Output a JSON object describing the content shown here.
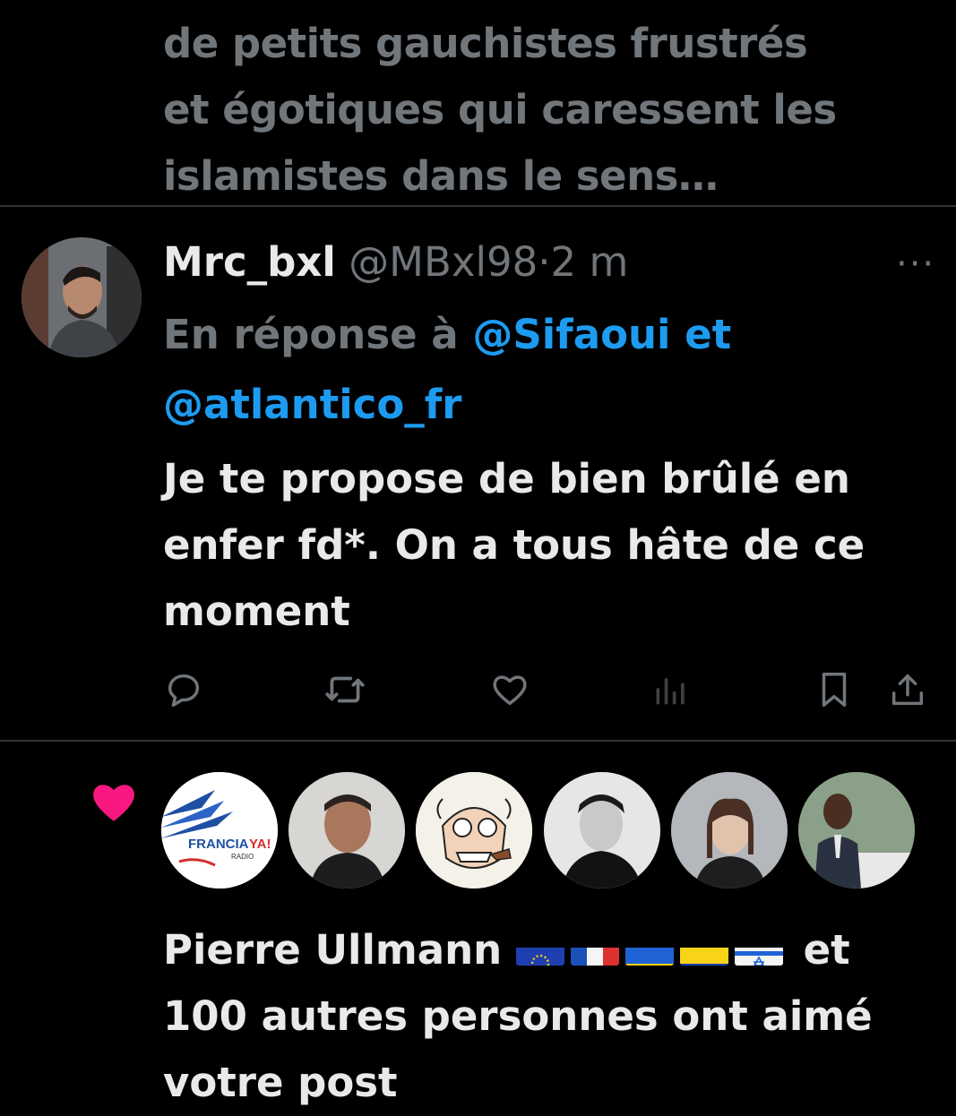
{
  "previous_tweet": {
    "text_lines": [
      "de petits gauchistes frustrés",
      "et égotiques qui caressent les",
      "islamistes dans le sens…"
    ]
  },
  "tweet": {
    "display_name": "Mrc_bxl",
    "handle": "@MBxl98",
    "separator": "·",
    "time": "2 m",
    "reply_prefix": "En réponse à",
    "reply_mention_1": "@Sifaoui",
    "reply_conjunction": "et",
    "reply_mention_2": "@atlantico_fr",
    "body_lines": [
      "Je te propose de bien brûlé en",
      "enfer fd*. On a tous hâte de ce",
      "moment"
    ],
    "more_label": "···"
  },
  "actions": [
    "reply-icon",
    "retweet-icon",
    "like-icon",
    "views-icon",
    "bookmark-icon",
    "share-icon"
  ],
  "notification": {
    "avatar_text": {
      "brand_a": "FRANCIA",
      "brand_b": "YA!",
      "brand_sub": "RADIO"
    },
    "liker_name": "Pierre Ullmann",
    "flags": [
      "eu-flag",
      "france-flag",
      "ukraine-flag",
      "colombia-flag",
      "israel-flag"
    ],
    "text_tail_1": "et",
    "text_line_2": "100 autres personnes ont aimé",
    "text_line_3": "votre post"
  },
  "colors": {
    "accent": "#1d9bf0",
    "muted": "#71767b",
    "like_pink": "#f91880",
    "divider": "#2f3336"
  }
}
